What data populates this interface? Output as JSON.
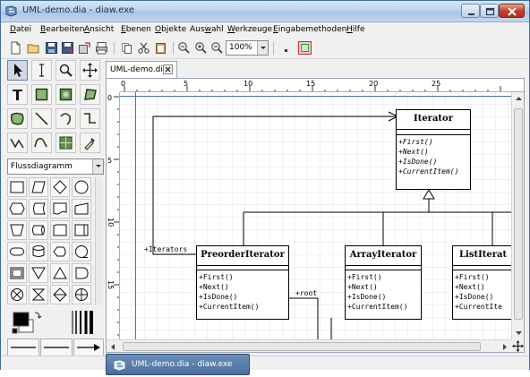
{
  "window": {
    "title": "UML-demo.dia - diaw.exe"
  },
  "menubar": {
    "items": [
      {
        "pre": "",
        "u": "D",
        "post": "atei"
      },
      {
        "pre": "",
        "u": "B",
        "post": "earbeiten"
      },
      {
        "pre": "",
        "u": "A",
        "post": "nsicht"
      },
      {
        "pre": "",
        "u": "E",
        "post": "benen"
      },
      {
        "pre": "",
        "u": "O",
        "post": "bjekte"
      },
      {
        "pre": "Aus",
        "u": "w",
        "post": "ahl"
      },
      {
        "pre": "",
        "u": "W",
        "post": "erkzeuge"
      },
      {
        "pre": "",
        "u": "E",
        "post": "ingabemethoden"
      },
      {
        "pre": "",
        "u": "H",
        "post": "ilfe"
      }
    ]
  },
  "toolbar": {
    "zoom_value": "100%"
  },
  "toolbox": {
    "sheet_selected": "Flussdiagramm"
  },
  "tabs": [
    {
      "label": "UML-demo.dia"
    }
  ],
  "rulers": {
    "horizontal": [
      "0",
      "5",
      "10",
      "15",
      "20",
      "25"
    ],
    "vertical": [
      "0",
      "5",
      "10",
      "15"
    ]
  },
  "diagram": {
    "classes": [
      {
        "name": "Iterator",
        "operations": [
          "+First()",
          "+Next()",
          "+IsDone()",
          "+CurrentItem()"
        ],
        "abstract": true
      },
      {
        "name": "PreorderIterator",
        "operations": [
          "+First()",
          "+Next()",
          "+IsDone()",
          "+CurrentItem()"
        ],
        "abstract": false
      },
      {
        "name": "ArrayIterator",
        "operations": [
          "+First()",
          "+Next()",
          "+IsDone()",
          "+CurrentItem()"
        ],
        "abstract": false
      },
      {
        "name": "ListIterat",
        "operations": [
          "+First()",
          "+Next()",
          "+IsDone()",
          "+CurrentIte"
        ],
        "abstract": false
      }
    ],
    "labels": {
      "iterators": "+Iterators",
      "root": "+root"
    }
  },
  "taskbar_popup": {
    "label": "UML-demo.dia - diaw.exe"
  },
  "colors": {
    "title_gradient_top": "#d7e6f6",
    "close_red": "#c7412a",
    "canvas_grid": "#e4e8f0",
    "guide_blue": "#4a6fb0"
  }
}
